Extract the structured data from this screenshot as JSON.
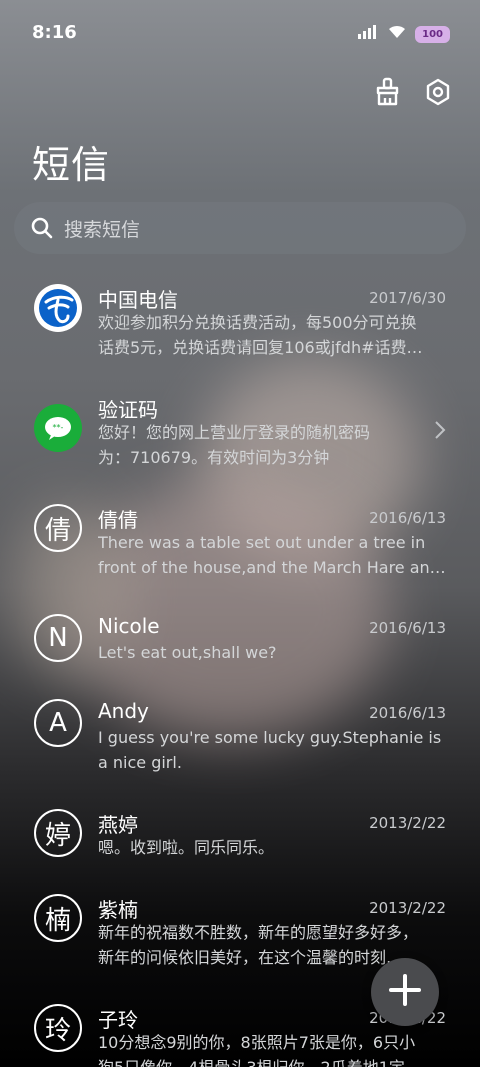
{
  "status": {
    "time": "8:16",
    "battery": "100"
  },
  "header": {
    "title": "短信"
  },
  "search": {
    "placeholder": "搜索短信"
  },
  "messages": [
    {
      "name": "中国电信",
      "date": "2017/6/30",
      "line1": "欢迎参加积分兑换话费活动，每500分可兑换",
      "line2": "话费5元，兑换话费请回复106或jfdh#话费…",
      "avatar": "telecom-logo"
    },
    {
      "name": "验证码",
      "date": "",
      "line1": "您好！您的网上营业厅登录的随机密码",
      "line2": "为：710679。有效时间为3分钟",
      "avatar": "wechat-icon"
    },
    {
      "name": "倩倩",
      "date": "2016/6/13",
      "line1": "There was a table set out under a tree in",
      "line2": "front of the house,and the March Hare an…",
      "avatar_char": "倩"
    },
    {
      "name": "Nicole",
      "date": "2016/6/13",
      "line1": "Let's eat out,shall we?",
      "line2": "",
      "avatar_char": "N"
    },
    {
      "name": "Andy",
      "date": "2016/6/13",
      "line1": "I guess you're some lucky guy.Stephanie is",
      "line2": "a nice girl.",
      "avatar_char": "A"
    },
    {
      "name": "燕婷",
      "date": "2013/2/22",
      "line1": "嗯。收到啦。同乐同乐。",
      "line2": "",
      "avatar_char": "婷"
    },
    {
      "name": "紫楠",
      "date": "2013/2/22",
      "line1": "新年的祝福数不胜数，新年的愿望好多好多，",
      "line2": "新年的问候依旧美好，在这个温馨的时刻…",
      "avatar_char": "楠"
    },
    {
      "name": "子玲",
      "date": "2013/2/22",
      "line1": "10分想念9别的你，8张照片7张是你，6只小",
      "line2": "狗5只像你，4根骨头3根归你，2瓜着地1定",
      "avatar_char": "玲"
    }
  ]
}
